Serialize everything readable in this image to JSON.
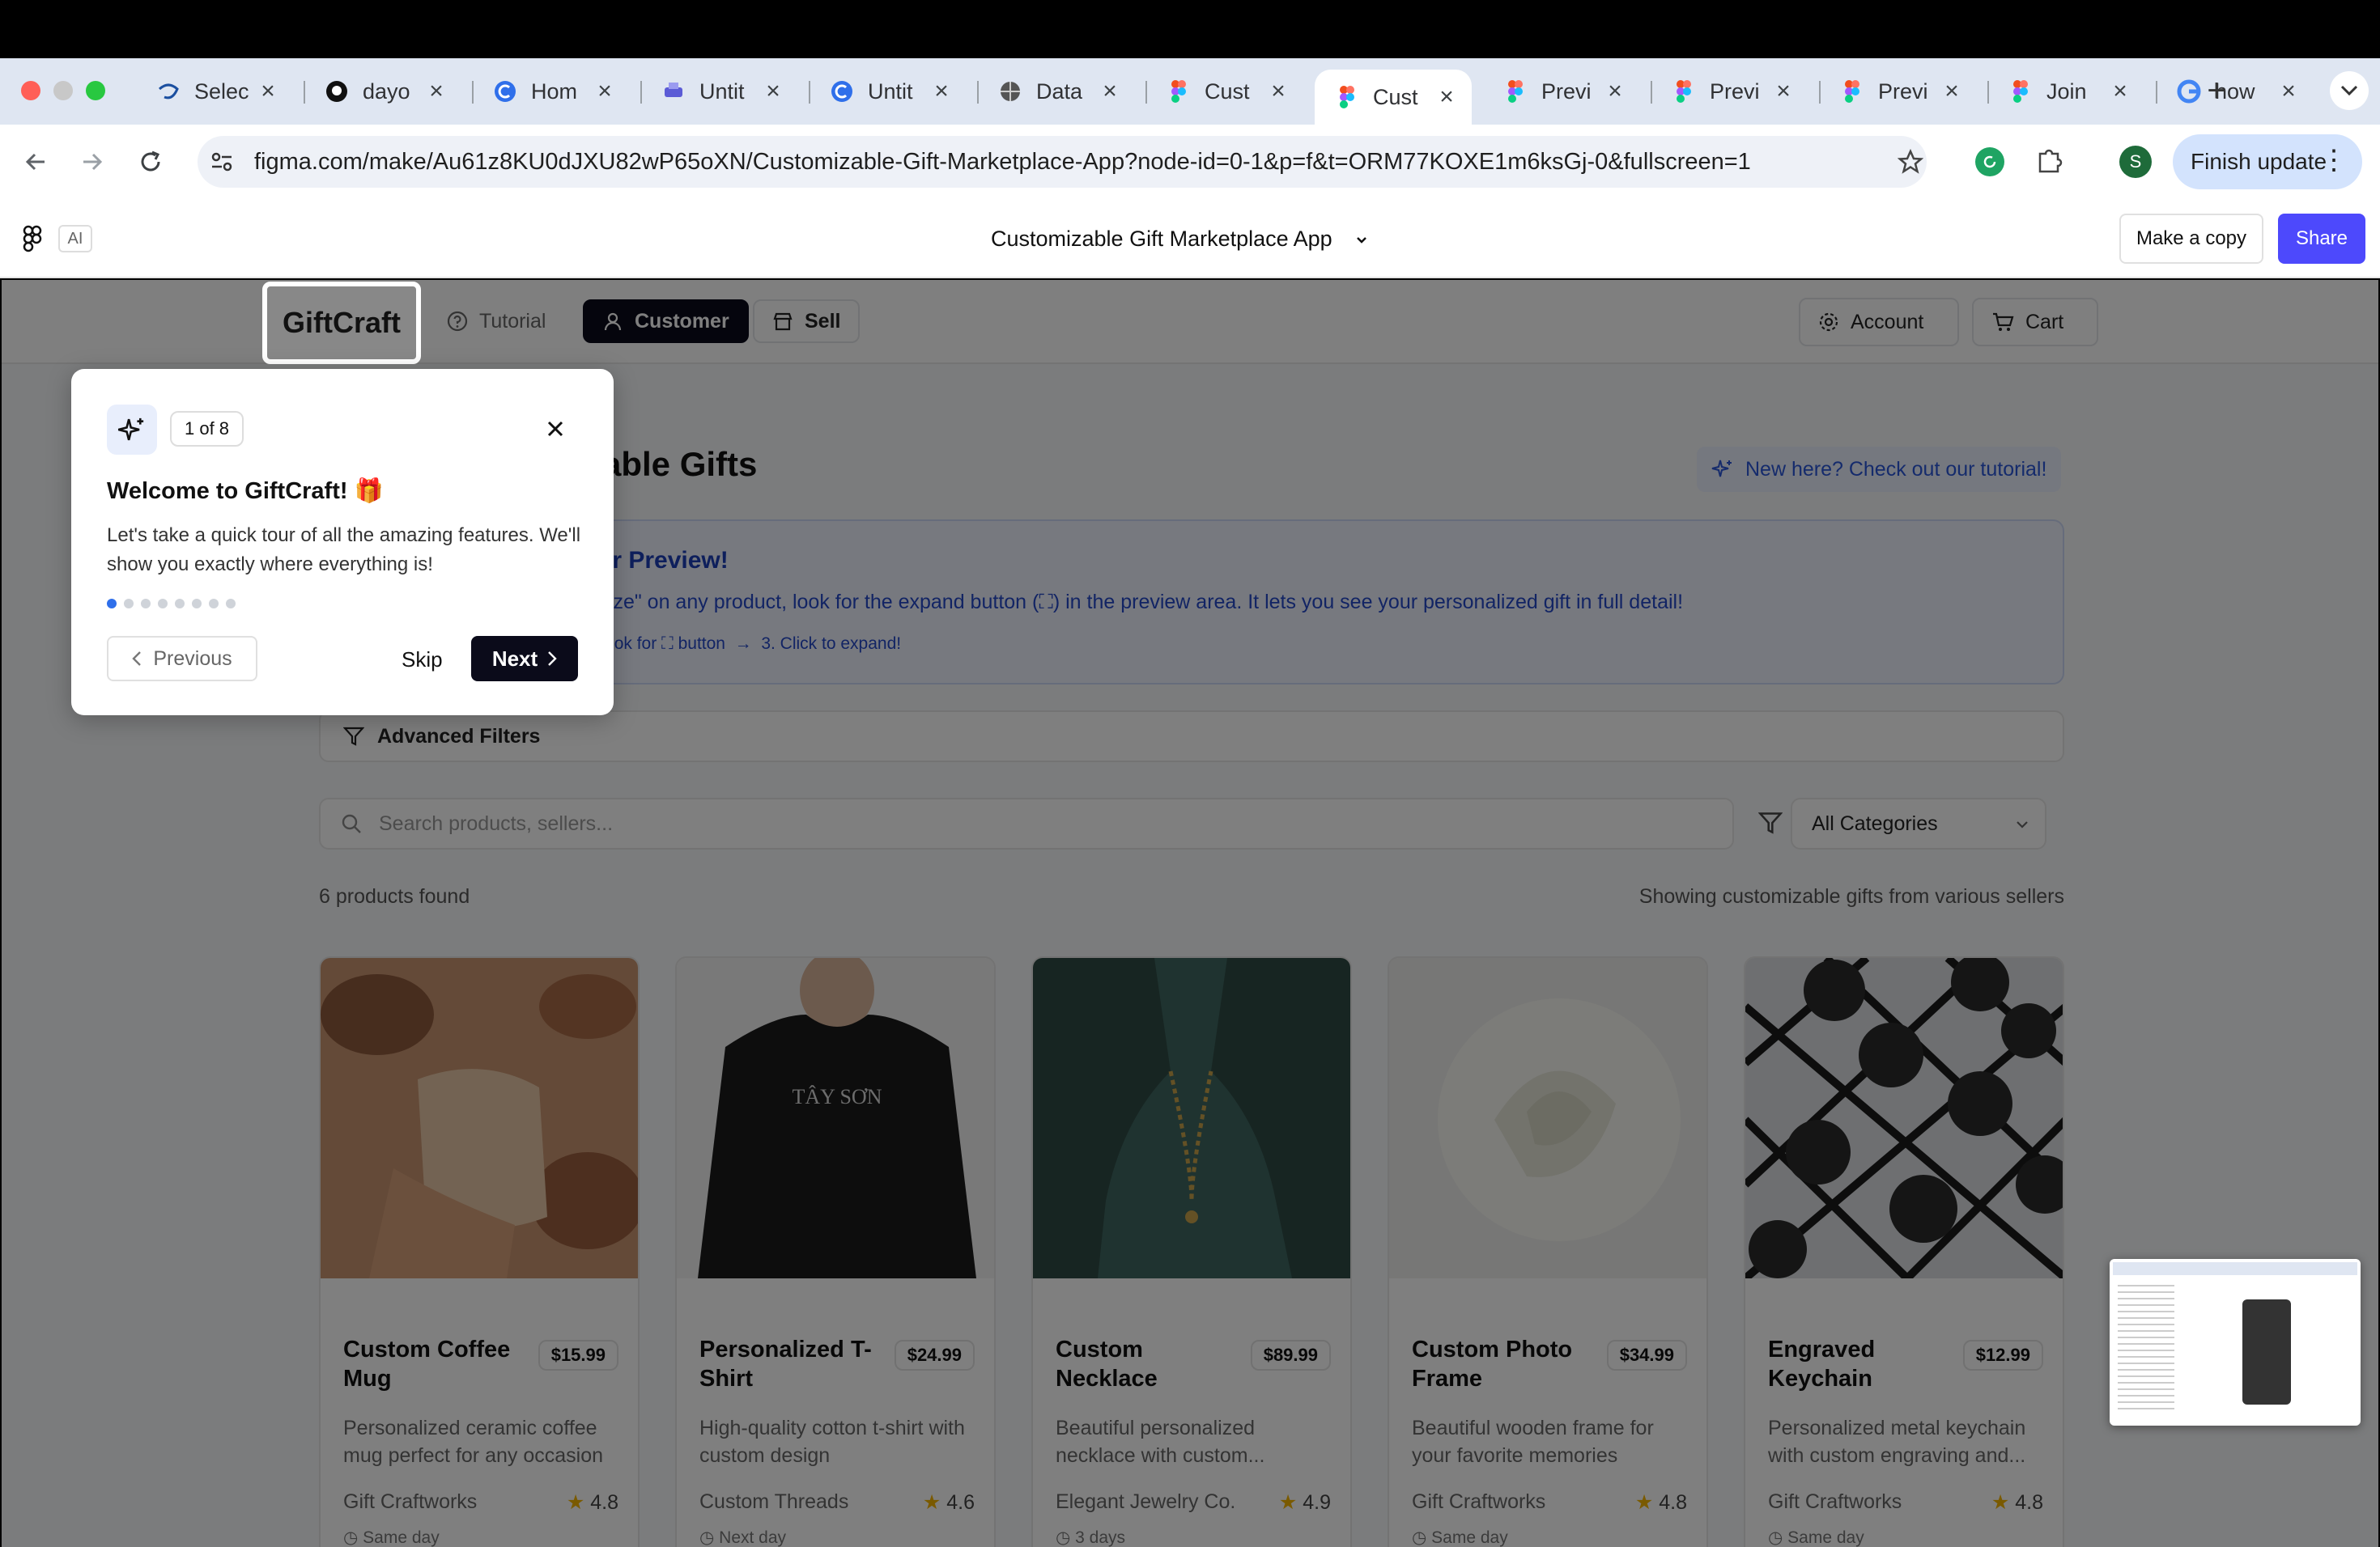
{
  "browser": {
    "tabs": [
      {
        "label": "Selec",
        "icon": "disney-icon"
      },
      {
        "label": "dayo",
        "icon": "github-icon"
      },
      {
        "label": "Hom",
        "icon": "c-icon"
      },
      {
        "label": "Untit",
        "icon": "printer-icon"
      },
      {
        "label": "Untit",
        "icon": "c-icon"
      },
      {
        "label": "Data",
        "icon": "globe-icon"
      },
      {
        "label": "Cust",
        "icon": "figma-icon"
      },
      {
        "label": "Cust",
        "icon": "figma-icon",
        "active": true
      },
      {
        "label": "Previ",
        "icon": "figma-icon"
      },
      {
        "label": "Previ",
        "icon": "figma-icon"
      },
      {
        "label": "Previ",
        "icon": "figma-icon"
      },
      {
        "label": "Join",
        "icon": "figma-icon"
      },
      {
        "label": "how",
        "icon": "google-icon"
      }
    ],
    "url": "figma.com/make/Au61z8KU0dJXU82wP65oXN/Customizable-Gift-Marketplace-App?node-id=0-1&p=f&t=ORM77KOXE1m6ksGj-0&fullscreen=1",
    "profile_initial": "S",
    "finish_update": "Finish update"
  },
  "figma": {
    "ai_badge": "AI",
    "title": "Customizable Gift Marketplace App",
    "make_copy": "Make a copy",
    "share": "Share"
  },
  "app": {
    "logo": "GiftCraft",
    "nav": {
      "tutorial": "Tutorial",
      "customer": "Customer",
      "sell": "Sell",
      "account": "Account",
      "cart": "Cart"
    },
    "heading_tail": "able Gifts",
    "tutorial_link": "New here? Check out our tutorial!",
    "banner": {
      "title_tail": "ur Preview!",
      "text_tail": "nize\" on any product, look for the expand button (⛶) in the preview area. It lets you see your personalized gift in full detail!",
      "steps_tail": "2. Look for ⛶ button  →  3. Click to expand!"
    },
    "advanced_filters": "Advanced Filters",
    "search_placeholder": "Search products, sellers...",
    "category": "All Categories",
    "found": "6 products found",
    "showing": "Showing customizable gifts from various sellers",
    "products": [
      {
        "name": "Custom Coffee Mug",
        "price": "$15.99",
        "desc": "Personalized ceramic coffee mug perfect for any occasion",
        "seller": "Gift Craftworks",
        "rating": "4.8",
        "delivery": "Same day"
      },
      {
        "name": "Personalized T-Shirt",
        "price": "$24.99",
        "desc": "High-quality cotton t-shirt with custom design",
        "seller": "Custom Threads",
        "rating": "4.6",
        "delivery": "Next day"
      },
      {
        "name": "Custom Necklace",
        "price": "$89.99",
        "desc": "Beautiful personalized necklace with custom...",
        "seller": "Elegant Jewelry Co.",
        "rating": "4.9",
        "delivery": "3 days"
      },
      {
        "name": "Custom Photo Frame",
        "price": "$34.99",
        "desc": "Beautiful wooden frame for your favorite memories",
        "seller": "Gift Craftworks",
        "rating": "4.8",
        "delivery": "Same day"
      },
      {
        "name": "Engraved Keychain",
        "price": "$12.99",
        "desc": "Personalized metal keychain with custom engraving and...",
        "seller": "Gift Craftworks",
        "rating": "4.8",
        "delivery": "Same day"
      }
    ],
    "tshirt_print": "TÂY SƠN"
  },
  "popup": {
    "step": "1 of 8",
    "title": "Welcome to GiftCraft! 🎁",
    "body": "Let's take a quick tour of all the amazing features. We'll show you exactly where everything is!",
    "total_steps": 8,
    "current_step": 1,
    "previous": "Previous",
    "skip": "Skip",
    "next": "Next"
  }
}
